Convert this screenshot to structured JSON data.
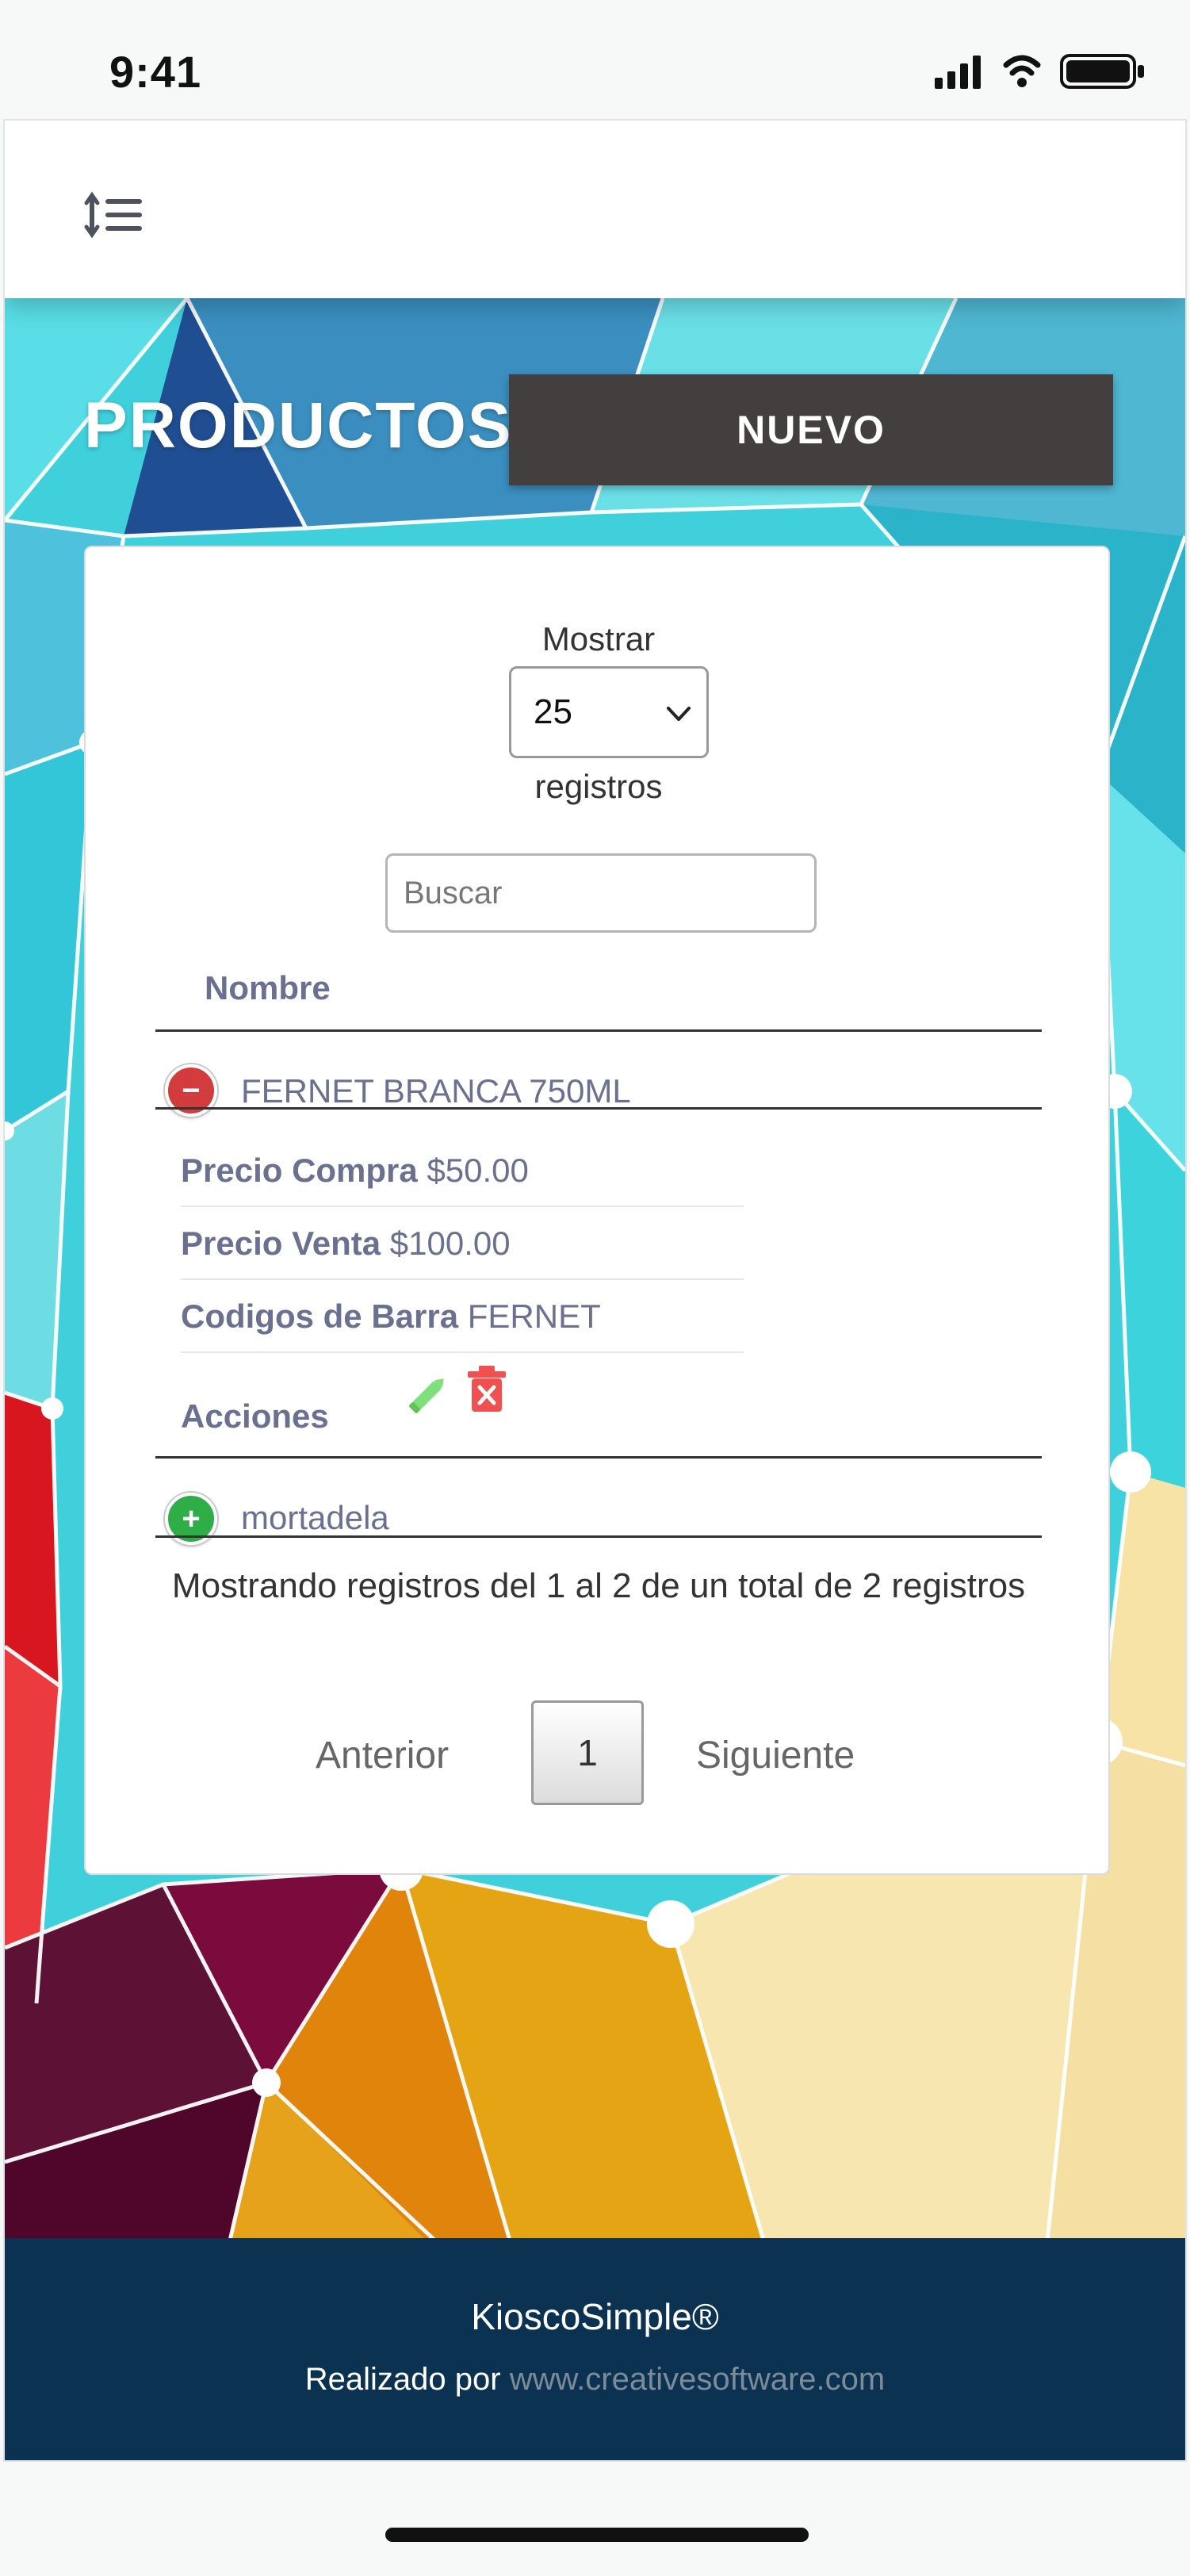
{
  "status_bar": {
    "time": "9:41"
  },
  "header": {
    "menu_icon": "sort-list-icon"
  },
  "page": {
    "title": "PRODUCTOS",
    "new_button_label": "NUEVO"
  },
  "table_controls": {
    "show_label": "Mostrar",
    "page_size": "25",
    "records_label": "registros",
    "search_placeholder": "Buscar"
  },
  "table": {
    "columns": [
      "Nombre"
    ],
    "rows": [
      {
        "name": "FERNET BRANCA 750ML",
        "expanded": true,
        "toggle_icon": "minus-circle-icon",
        "details": {
          "purchase_price_label": "Precio Compra",
          "purchase_price": "$50.00",
          "sale_price_label": "Precio Venta",
          "sale_price": "$100.00",
          "barcodes_label": "Codigos de Barra",
          "barcodes": "FERNET",
          "actions_label": "Acciones",
          "action_icons": [
            "pencil-edit-icon",
            "trash-delete-icon"
          ]
        }
      },
      {
        "name": "mortadela",
        "expanded": false,
        "toggle_icon": "plus-circle-icon"
      }
    ]
  },
  "table_info": "Mostrando registros del 1 al 2 de un total de 2 registros",
  "pagination": {
    "previous_label": "Anterior",
    "current_page": "1",
    "next_label": "Siguiente"
  },
  "footer": {
    "brand": "KioscoSimple®",
    "credit_prefix": "Realizado por",
    "credit_link": "www.creativesoftware.com"
  },
  "colors": {
    "button_dark": "#433f3e",
    "footer_navy": "#0c3252",
    "label_slate": "#6a7090",
    "edit_green": "#7ee07a",
    "delete_red": "#f05050"
  }
}
